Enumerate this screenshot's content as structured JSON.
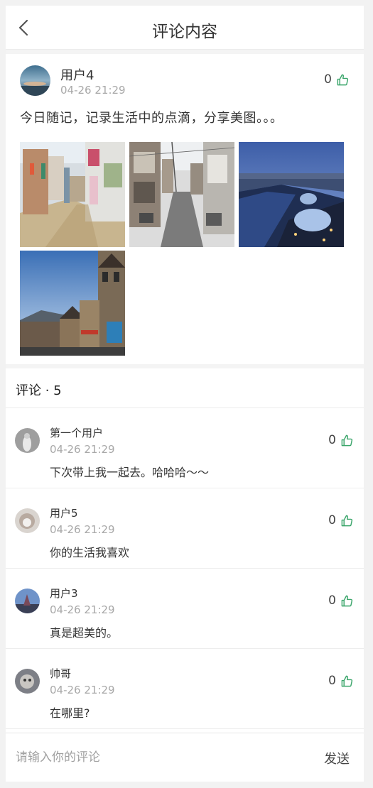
{
  "navbar": {
    "title": "评论内容"
  },
  "post": {
    "user": "用户4",
    "time": "04-26 21:29",
    "likes": "0",
    "text": "今日随记，记录生活中的点滴，分享美图。。。",
    "photos": [
      "street-alley-photo",
      "narrow-lane-photo",
      "city-bay-night-photo",
      "stone-townhouses-photo"
    ]
  },
  "comments_section": {
    "label": "评论 · 5",
    "items": [
      {
        "user": "第一个用户",
        "time": "04-26 21:29",
        "text": "下次带上我一起去。哈哈哈～～",
        "likes": "0"
      },
      {
        "user": "用户5",
        "time": "04-26 21:29",
        "text": "你的生活我喜欢",
        "likes": "0"
      },
      {
        "user": "用户3",
        "time": "04-26 21:29",
        "text": "真是超美的。",
        "likes": "0"
      },
      {
        "user": "帅哥",
        "time": "04-26 21:29",
        "text": "在哪里?",
        "likes": "0"
      }
    ]
  },
  "input_bar": {
    "placeholder": "请输入你的评论",
    "send_label": "发送"
  },
  "colors": {
    "accent": "#3aa56a",
    "muted": "#a8a8a8",
    "divider": "#ededed"
  },
  "icons": [
    "chevron-left-icon",
    "thumbs-up-icon"
  ]
}
